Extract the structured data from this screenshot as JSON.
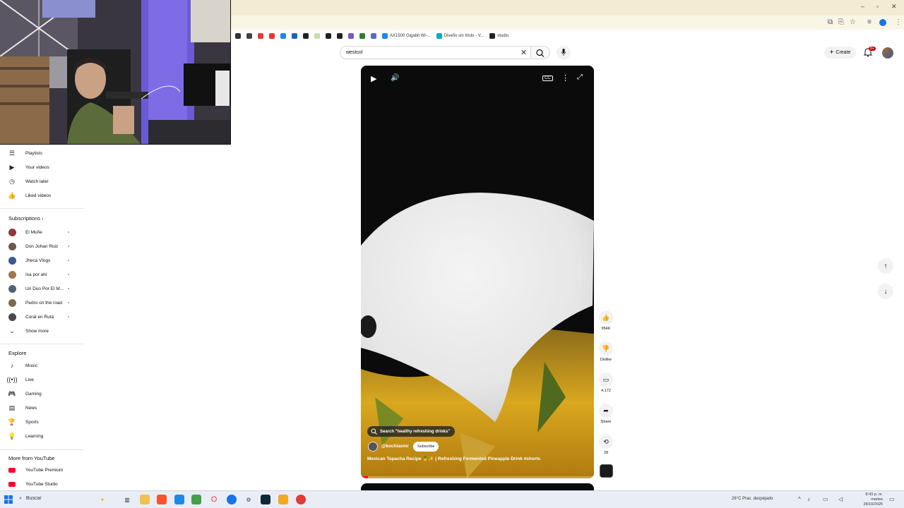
{
  "search": {
    "value": "westcol"
  },
  "header": {
    "create_label": "Create",
    "notifications_count": "9+"
  },
  "bookmarks": [
    {
      "label": "",
      "color": "#333333"
    },
    {
      "label": "",
      "color": "#444444"
    },
    {
      "label": "",
      "color": "#e53935"
    },
    {
      "label": "",
      "color": "#e53935"
    },
    {
      "label": "",
      "color": "#1e88e5"
    },
    {
      "label": "",
      "color": "#1565c0"
    },
    {
      "label": "",
      "color": "#222222"
    },
    {
      "label": "",
      "color": "#c5e1a5"
    },
    {
      "label": "",
      "color": "#222222"
    },
    {
      "label": "",
      "color": "#222222"
    },
    {
      "label": "",
      "color": "#7e57c2"
    },
    {
      "label": "",
      "color": "#2e7d32"
    },
    {
      "label": "",
      "color": "#5c6bc0"
    },
    {
      "label": "AX1500 Gigabit Wi-...",
      "color": "#1e88e5"
    },
    {
      "label": "Diseño sin título - V...",
      "color": "#00acc1"
    },
    {
      "label": "studio",
      "color": "#222222"
    }
  ],
  "sidebar": {
    "you_items": [
      {
        "label": "Playlists",
        "icon": "☰"
      },
      {
        "label": "Your videos",
        "icon": "▶"
      },
      {
        "label": "Watch later",
        "icon": "◷"
      },
      {
        "label": "Liked videos",
        "icon": "👍"
      }
    ],
    "subscriptions_title": "Subscriptions",
    "subscriptions": [
      {
        "label": "El Muñe",
        "color": "#8d3b3b"
      },
      {
        "label": "Don Johan Ruiz",
        "color": "#6d5a4a"
      },
      {
        "label": "Jheca Vlogs",
        "color": "#3b5a8d"
      },
      {
        "label": "Isa por ahí",
        "color": "#a0754a"
      },
      {
        "label": "Un Duo Por El M...",
        "color": "#556070"
      },
      {
        "label": "Pedro on the road",
        "color": "#7a6a4a"
      },
      {
        "label": "Coral en Ruta",
        "color": "#4a4a4a"
      }
    ],
    "show_more": "Show more",
    "explore_title": "Explore",
    "explore": [
      {
        "label": "Music",
        "icon": "♪"
      },
      {
        "label": "Live",
        "icon": "((•))"
      },
      {
        "label": "Gaming",
        "icon": "🎮"
      },
      {
        "label": "News",
        "icon": "▤"
      },
      {
        "label": "Sports",
        "icon": "🏆"
      },
      {
        "label": "Learning",
        "icon": "💡"
      }
    ],
    "more_title": "More from YouTube",
    "more": [
      {
        "label": "YouTube Premium",
        "color": "#ff0033"
      },
      {
        "label": "YouTube Studio",
        "color": "#ff0033"
      }
    ]
  },
  "short": {
    "suggest": "Search \"healthy refreshing drinks\"",
    "channel": "@kochiasmr",
    "subscribe": "Subscribe",
    "title": "Mexican Tepacha Recipe 🍍✨ | Refreshing Fermented Pineapple Drink #shorts",
    "progress": 0.03
  },
  "actions": {
    "likes": "954K",
    "dislike": "Dislike",
    "comments": "4,172",
    "share": "Share",
    "remix": "28"
  },
  "taskbar": {
    "search": "Buscar",
    "weather": "26°C  Prac. despejado",
    "time": "8:43 p. m.",
    "day": "martes",
    "date": "28/10/2025"
  }
}
